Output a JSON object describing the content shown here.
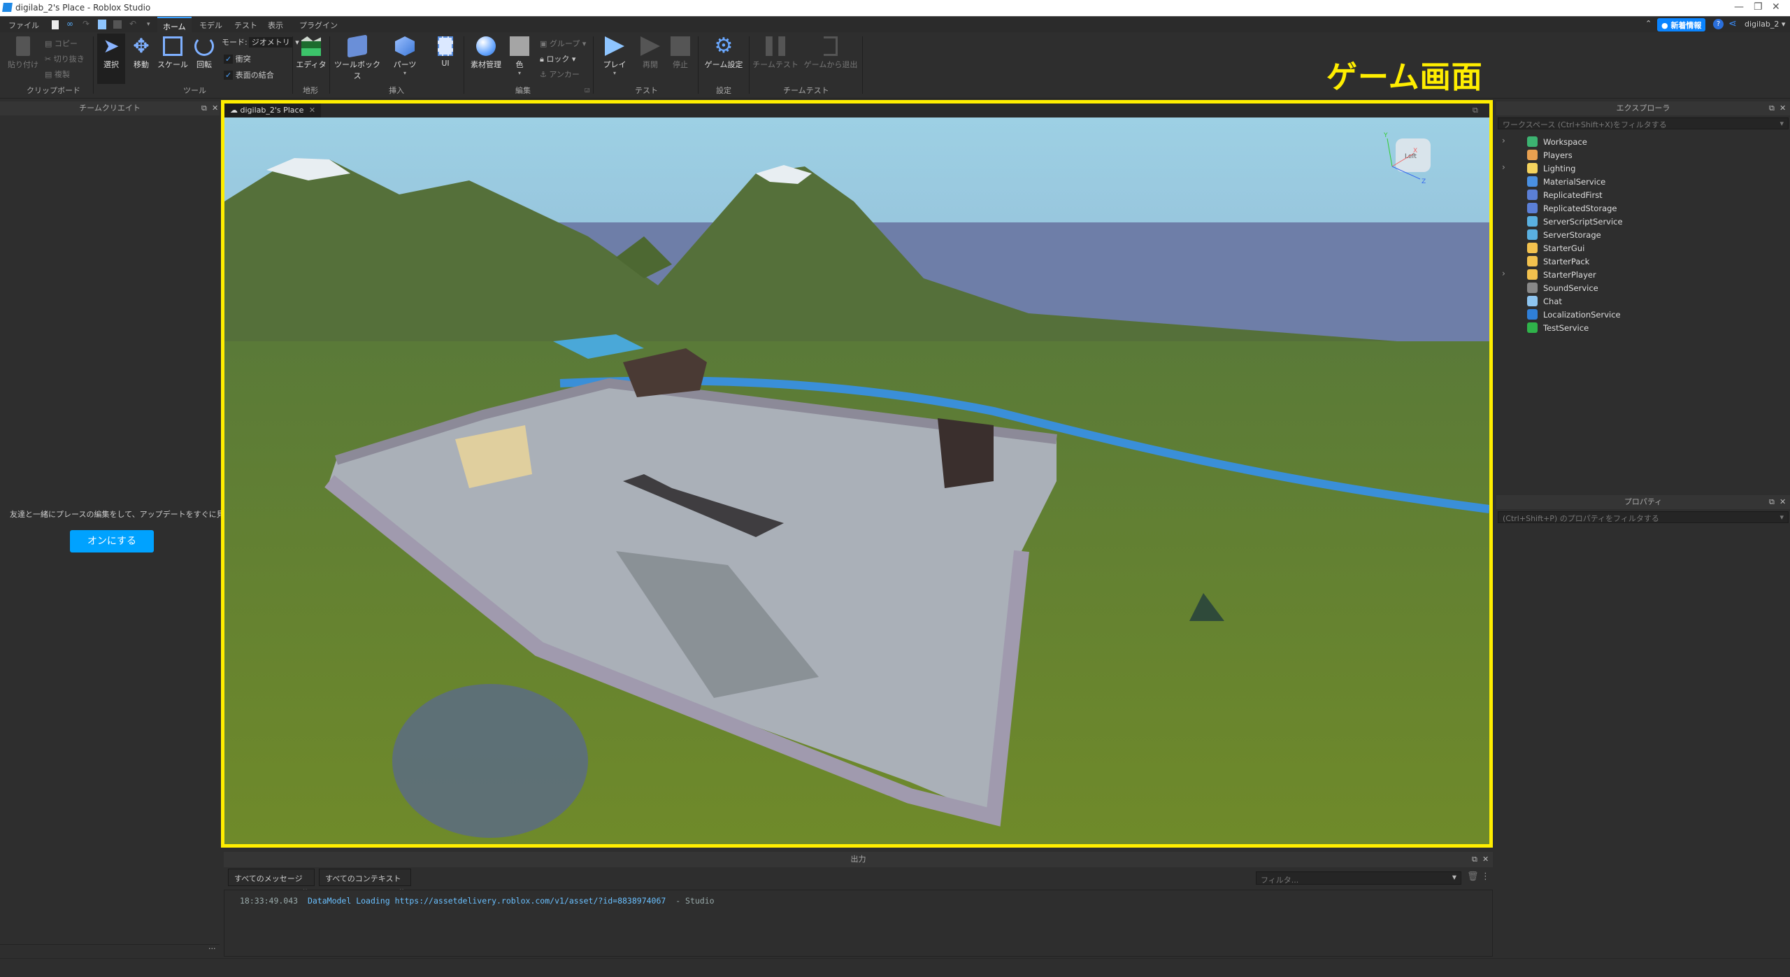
{
  "window": {
    "title": "digilab_2's Place - Roblox Studio"
  },
  "menu": {
    "file": "ファイル",
    "tabs": [
      {
        "label": "ホーム",
        "active": true
      },
      {
        "label": "モデル"
      },
      {
        "label": "テスト"
      },
      {
        "label": "表示"
      },
      {
        "label": "プラグイン"
      }
    ],
    "whats_new": "新着情報",
    "user": "digilab_2"
  },
  "ribbon": {
    "clipboard": {
      "paste": "貼り付け",
      "copy": "コピー",
      "cut": "切り抜き",
      "duplicate": "複製",
      "group": "クリップボード"
    },
    "tools": {
      "select": "選択",
      "move": "移動",
      "scale": "スケール",
      "rotate": "回転",
      "mode_label": "モード:",
      "mode_value": "ジオメトリ",
      "collisions": "衝突",
      "join_surfaces": "表面の結合",
      "collisions_checked": true,
      "join_surfaces_checked": true,
      "group": "ツール"
    },
    "terrain": {
      "editor": "エディタ",
      "group": "地形"
    },
    "insert": {
      "toolbox": "ツールボックス",
      "part": "パーツ",
      "ui": "UI",
      "group": "挿入"
    },
    "edit": {
      "material": "素材管理",
      "color": "色",
      "group_btn": "グループ",
      "lock": "ロック",
      "anchor": "アンカー",
      "group": "編集"
    },
    "test": {
      "play": "プレイ",
      "resume": "再開",
      "stop": "停止",
      "group": "テスト"
    },
    "settings": {
      "game_settings": "ゲーム設定",
      "group": "設定"
    },
    "team_test": {
      "team_test": "チームテスト",
      "exit_game": "ゲームから退出",
      "group": "チームテスト"
    }
  },
  "annotation": {
    "label": "ゲーム画面",
    "color": "#ffee00"
  },
  "team_create": {
    "title": "チームクリエイト",
    "message": "友達と一緒にプレースの編集をして、アップデートをすぐに見る。",
    "button": "オンにする",
    "more": "..."
  },
  "viewport": {
    "tab": "digilab_2's Place",
    "cube_face": "Left",
    "axes": [
      "X",
      "Y",
      "Z"
    ]
  },
  "explorer": {
    "title": "エクスプローラ",
    "filter_placeholder": "ワークスペース (Ctrl+Shift+X)をフィルタする",
    "items": [
      {
        "name": "Workspace",
        "expandable": true,
        "icon": "globe-icon",
        "color": "#3cb371"
      },
      {
        "name": "Players",
        "expandable": false,
        "icon": "players-icon",
        "color": "#e8a050"
      },
      {
        "name": "Lighting",
        "expandable": true,
        "icon": "lightbulb-icon",
        "color": "#f4d35e"
      },
      {
        "name": "MaterialService",
        "expandable": false,
        "icon": "material-icon",
        "color": "#4a90e2"
      },
      {
        "name": "ReplicatedFirst",
        "expandable": false,
        "icon": "replicated-icon",
        "color": "#5b7fd6"
      },
      {
        "name": "ReplicatedStorage",
        "expandable": false,
        "icon": "replicated-icon",
        "color": "#5b7fd6"
      },
      {
        "name": "ServerScriptService",
        "expandable": false,
        "icon": "server-script-icon",
        "color": "#5ab0e0"
      },
      {
        "name": "ServerStorage",
        "expandable": false,
        "icon": "server-storage-icon",
        "color": "#5ab0e0"
      },
      {
        "name": "StarterGui",
        "expandable": false,
        "icon": "folder-gui-icon",
        "color": "#f2c14e"
      },
      {
        "name": "StarterPack",
        "expandable": false,
        "icon": "folder-pack-icon",
        "color": "#f2c14e"
      },
      {
        "name": "StarterPlayer",
        "expandable": true,
        "icon": "folder-player-icon",
        "color": "#f2c14e"
      },
      {
        "name": "SoundService",
        "expandable": false,
        "icon": "speaker-icon",
        "color": "#888888"
      },
      {
        "name": "Chat",
        "expandable": false,
        "icon": "chat-icon",
        "color": "#8ec5f0"
      },
      {
        "name": "LocalizationService",
        "expandable": false,
        "icon": "localization-icon",
        "color": "#2f7fd8"
      },
      {
        "name": "TestService",
        "expandable": false,
        "icon": "check-icon",
        "color": "#2fb34a"
      }
    ]
  },
  "properties": {
    "title": "プロパティ",
    "filter_placeholder": "(Ctrl+Shift+P) のプロパティをフィルタする"
  },
  "output": {
    "title": "出力",
    "messages_filter": "すべてのメッセージ",
    "context_filter": "すべてのコンテキスト",
    "search_placeholder": "フィルタ...",
    "log": [
      {
        "time": "18:33:49.043",
        "text": "DataModel Loading",
        "url": "https://assetdelivery.roblox.com/v1/asset/?id=8838974067",
        "source": "-  Studio"
      }
    ]
  }
}
